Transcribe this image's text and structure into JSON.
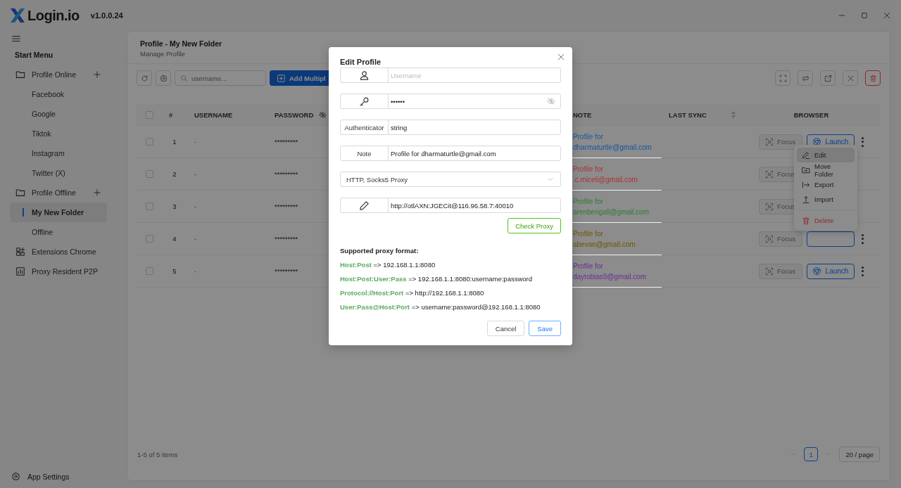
{
  "app": {
    "name": "Login.io",
    "version": "v1.0.0.24"
  },
  "sidebar": {
    "title": "Start Menu",
    "items": [
      {
        "label": "Profile Online",
        "kind": "folder",
        "selected": false,
        "children": [
          {
            "label": "Facebook",
            "selected": false
          },
          {
            "label": "Google",
            "selected": false
          },
          {
            "label": "Tiktok",
            "selected": false
          },
          {
            "label": "Instagram",
            "selected": false
          },
          {
            "label": "Twitter (X)",
            "selected": false
          }
        ]
      },
      {
        "label": "Profile Offline",
        "kind": "folder",
        "selected": false,
        "children": [
          {
            "label": "My New Folder",
            "selected": true
          },
          {
            "label": "Offline",
            "selected": false
          }
        ]
      },
      {
        "label": "Extensions Chrome",
        "kind": "extensions",
        "selected": false
      },
      {
        "label": "Proxy Resident P2P",
        "kind": "proxy",
        "selected": false
      }
    ],
    "footer": "App Settings"
  },
  "page": {
    "title": "Profile - My New Folder",
    "subtitle": "Manage Profile"
  },
  "toolbar": {
    "search_placeholder": "username...",
    "add_button": "Add Multipl"
  },
  "table": {
    "all_checked": false,
    "columns": [
      {
        "label": "#",
        "kind": "plain"
      },
      {
        "label": "USERNAME",
        "kind": "plain"
      },
      {
        "label": "PASSWORD",
        "kind": "hide"
      },
      {
        "label": "NOTE",
        "kind": "plain"
      },
      {
        "label": "LAST SYNC",
        "kind": "sort"
      },
      {
        "label": "BROWSER",
        "kind": "center"
      }
    ],
    "rows": [
      {
        "checked": false,
        "index": "1",
        "username": "-",
        "password": "*********",
        "note": [
          "Profile for",
          "dharmaturtle@gmail.com"
        ],
        "color": "#1a56a0",
        "focus": {
          "label": "Focus",
          "disabled": true
        },
        "launch": {
          "label": "Launch"
        },
        "more": true
      },
      {
        "checked": false,
        "index": "2",
        "username": "-",
        "password": "*********",
        "note": [
          "Profile for",
          ".c.miceli@gmail.com"
        ],
        "color": "#b03030",
        "focus": {
          "label": "Focus",
          "disabled": true
        },
        "more": false
      },
      {
        "checked": false,
        "index": "3",
        "username": "-",
        "password": "*********",
        "note": [
          "Profile for",
          "arenbengall@gmail.com"
        ],
        "color": "#2e7d32",
        "focus": {
          "label": "Focus",
          "disabled": true
        },
        "more": false
      },
      {
        "checked": false,
        "index": "4",
        "username": "-",
        "password": "*********",
        "note": [
          "Profile for",
          "abevan@gmail.com"
        ],
        "color": "#6e5500",
        "focus": {
          "label": "Focus",
          "disabled": true
        },
        "launch": {
          "covered": true
        },
        "more": true
      },
      {
        "checked": false,
        "index": "5",
        "username": "-",
        "password": "*********",
        "note": [
          "Profile for",
          "daytobias9@gmail.com"
        ],
        "color": "#6a2d9a",
        "focus": {
          "label": "Focus",
          "disabled": true
        },
        "launch": {
          "label": "Launch"
        },
        "more": true
      }
    ]
  },
  "row_menu": {
    "items": [
      {
        "label": "Edit",
        "kind": "edit",
        "selected": true
      },
      {
        "label": "Move Folder",
        "kind": "move",
        "selected": false
      },
      {
        "label": "Export",
        "kind": "export",
        "selected": false
      },
      {
        "label": "Import",
        "kind": "import",
        "selected": false
      },
      {
        "label": "Delete",
        "kind": "delete",
        "selected": false
      }
    ]
  },
  "pagination": {
    "summary": "1-5 of 5 items",
    "pages": [
      {
        "label": "1",
        "selected": true
      }
    ],
    "page_size": "20 / page"
  },
  "dialog": {
    "title": "Edit Profile",
    "fields": [
      {
        "kind": "user",
        "placeholder": "Username"
      },
      {
        "kind": "password",
        "value": "••••••"
      },
      {
        "kind": "labeled",
        "label": "Authenticator",
        "value": "string"
      },
      {
        "kind": "labeled",
        "label": "Note",
        "value": "Profile for dharmaturtle@gmail.com"
      },
      {
        "kind": "select",
        "value": "HTTP, Socks5 Proxy"
      },
      {
        "kind": "proxy",
        "value": "http://otlAXN:JGECit@116.96.58.7:40010"
      }
    ],
    "check_button": "Check Proxy",
    "formats_title": "Supported proxy format:",
    "formats": [
      "**Host:Post** => 192.168.1.1:8080",
      "**Host:Post:User:Pass** => 192.168.1.1:8080:username:password",
      "**Protocol://Host:Port** => http://192.168.1.1:8080",
      "**User:Pass@Host:Port** => username:password@192.168.1.1:8080"
    ],
    "buttons": [
      {
        "label": "Cancel",
        "kind": "default"
      },
      {
        "label": "Save",
        "kind": "primary"
      }
    ]
  }
}
